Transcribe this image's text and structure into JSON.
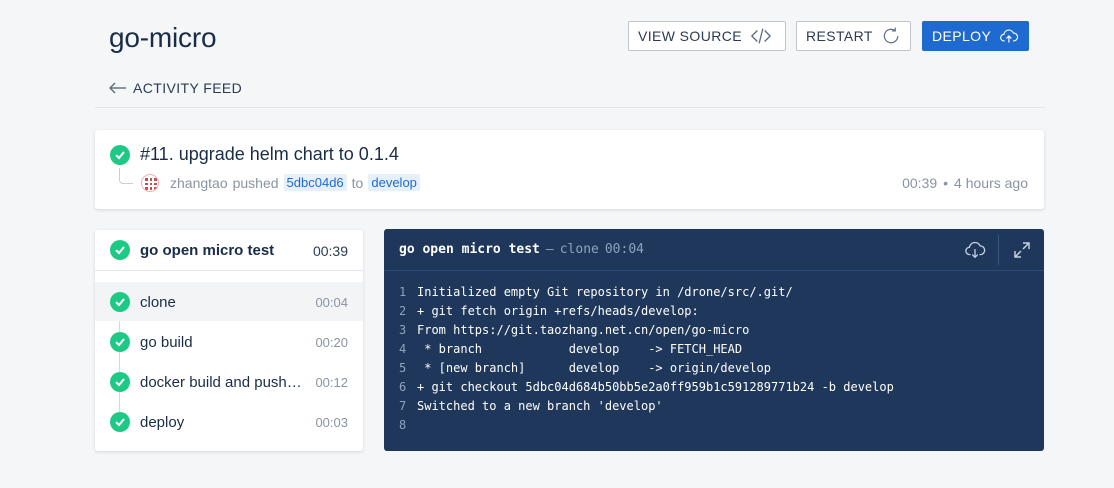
{
  "header": {
    "title": "go-micro",
    "buttons": {
      "view_source": "VIEW SOURCE",
      "restart": "RESTART",
      "deploy": "DEPLOY"
    },
    "back_label": "ACTIVITY FEED"
  },
  "commit": {
    "title": "#11. upgrade helm chart to 0.1.4",
    "author": "zhangtao",
    "action": "pushed",
    "sha": "5dbc04d6",
    "to": "to",
    "branch": "develop",
    "duration": "00:39",
    "separator": "•",
    "ago": "4 hours ago"
  },
  "stage": {
    "name": "go open micro test",
    "duration": "00:39",
    "steps": [
      {
        "name": "clone",
        "duration": "00:04",
        "active": true
      },
      {
        "name": "go build",
        "duration": "00:20"
      },
      {
        "name": "docker build and push to registry",
        "duration": "00:12"
      },
      {
        "name": "deploy",
        "duration": "00:03"
      }
    ]
  },
  "log": {
    "stage": "go open micro test",
    "dash": "—",
    "step": "clone",
    "duration": "00:04",
    "lines": [
      {
        "n": "1",
        "text": "Initialized empty Git repository in /drone/src/.git/"
      },
      {
        "n": "2",
        "text": "+ git fetch origin +refs/heads/develop:"
      },
      {
        "n": "3",
        "text": "From https://git.taozhang.net.cn/open/go-micro"
      },
      {
        "n": "4",
        "text": " * branch            develop    -> FETCH_HEAD"
      },
      {
        "n": "5",
        "text": " * [new branch]      develop    -> origin/develop"
      },
      {
        "n": "6",
        "text": "+ git checkout 5dbc04d684b50bb5e2a0ff959b1c591289771b24 -b develop"
      },
      {
        "n": "7",
        "text": "Switched to a new branch 'develop'"
      },
      {
        "n": "8",
        "text": ""
      }
    ]
  },
  "colors": {
    "success": "#1ec986",
    "accent": "#1e6ad0",
    "log_bg": "#1e375a"
  },
  "icons": {
    "view_source": "code-icon",
    "restart": "restart-icon",
    "deploy": "cloud-upload-icon",
    "back": "arrow-left-icon",
    "download": "cloud-download-icon",
    "expand": "expand-icon",
    "status": "check-icon"
  }
}
